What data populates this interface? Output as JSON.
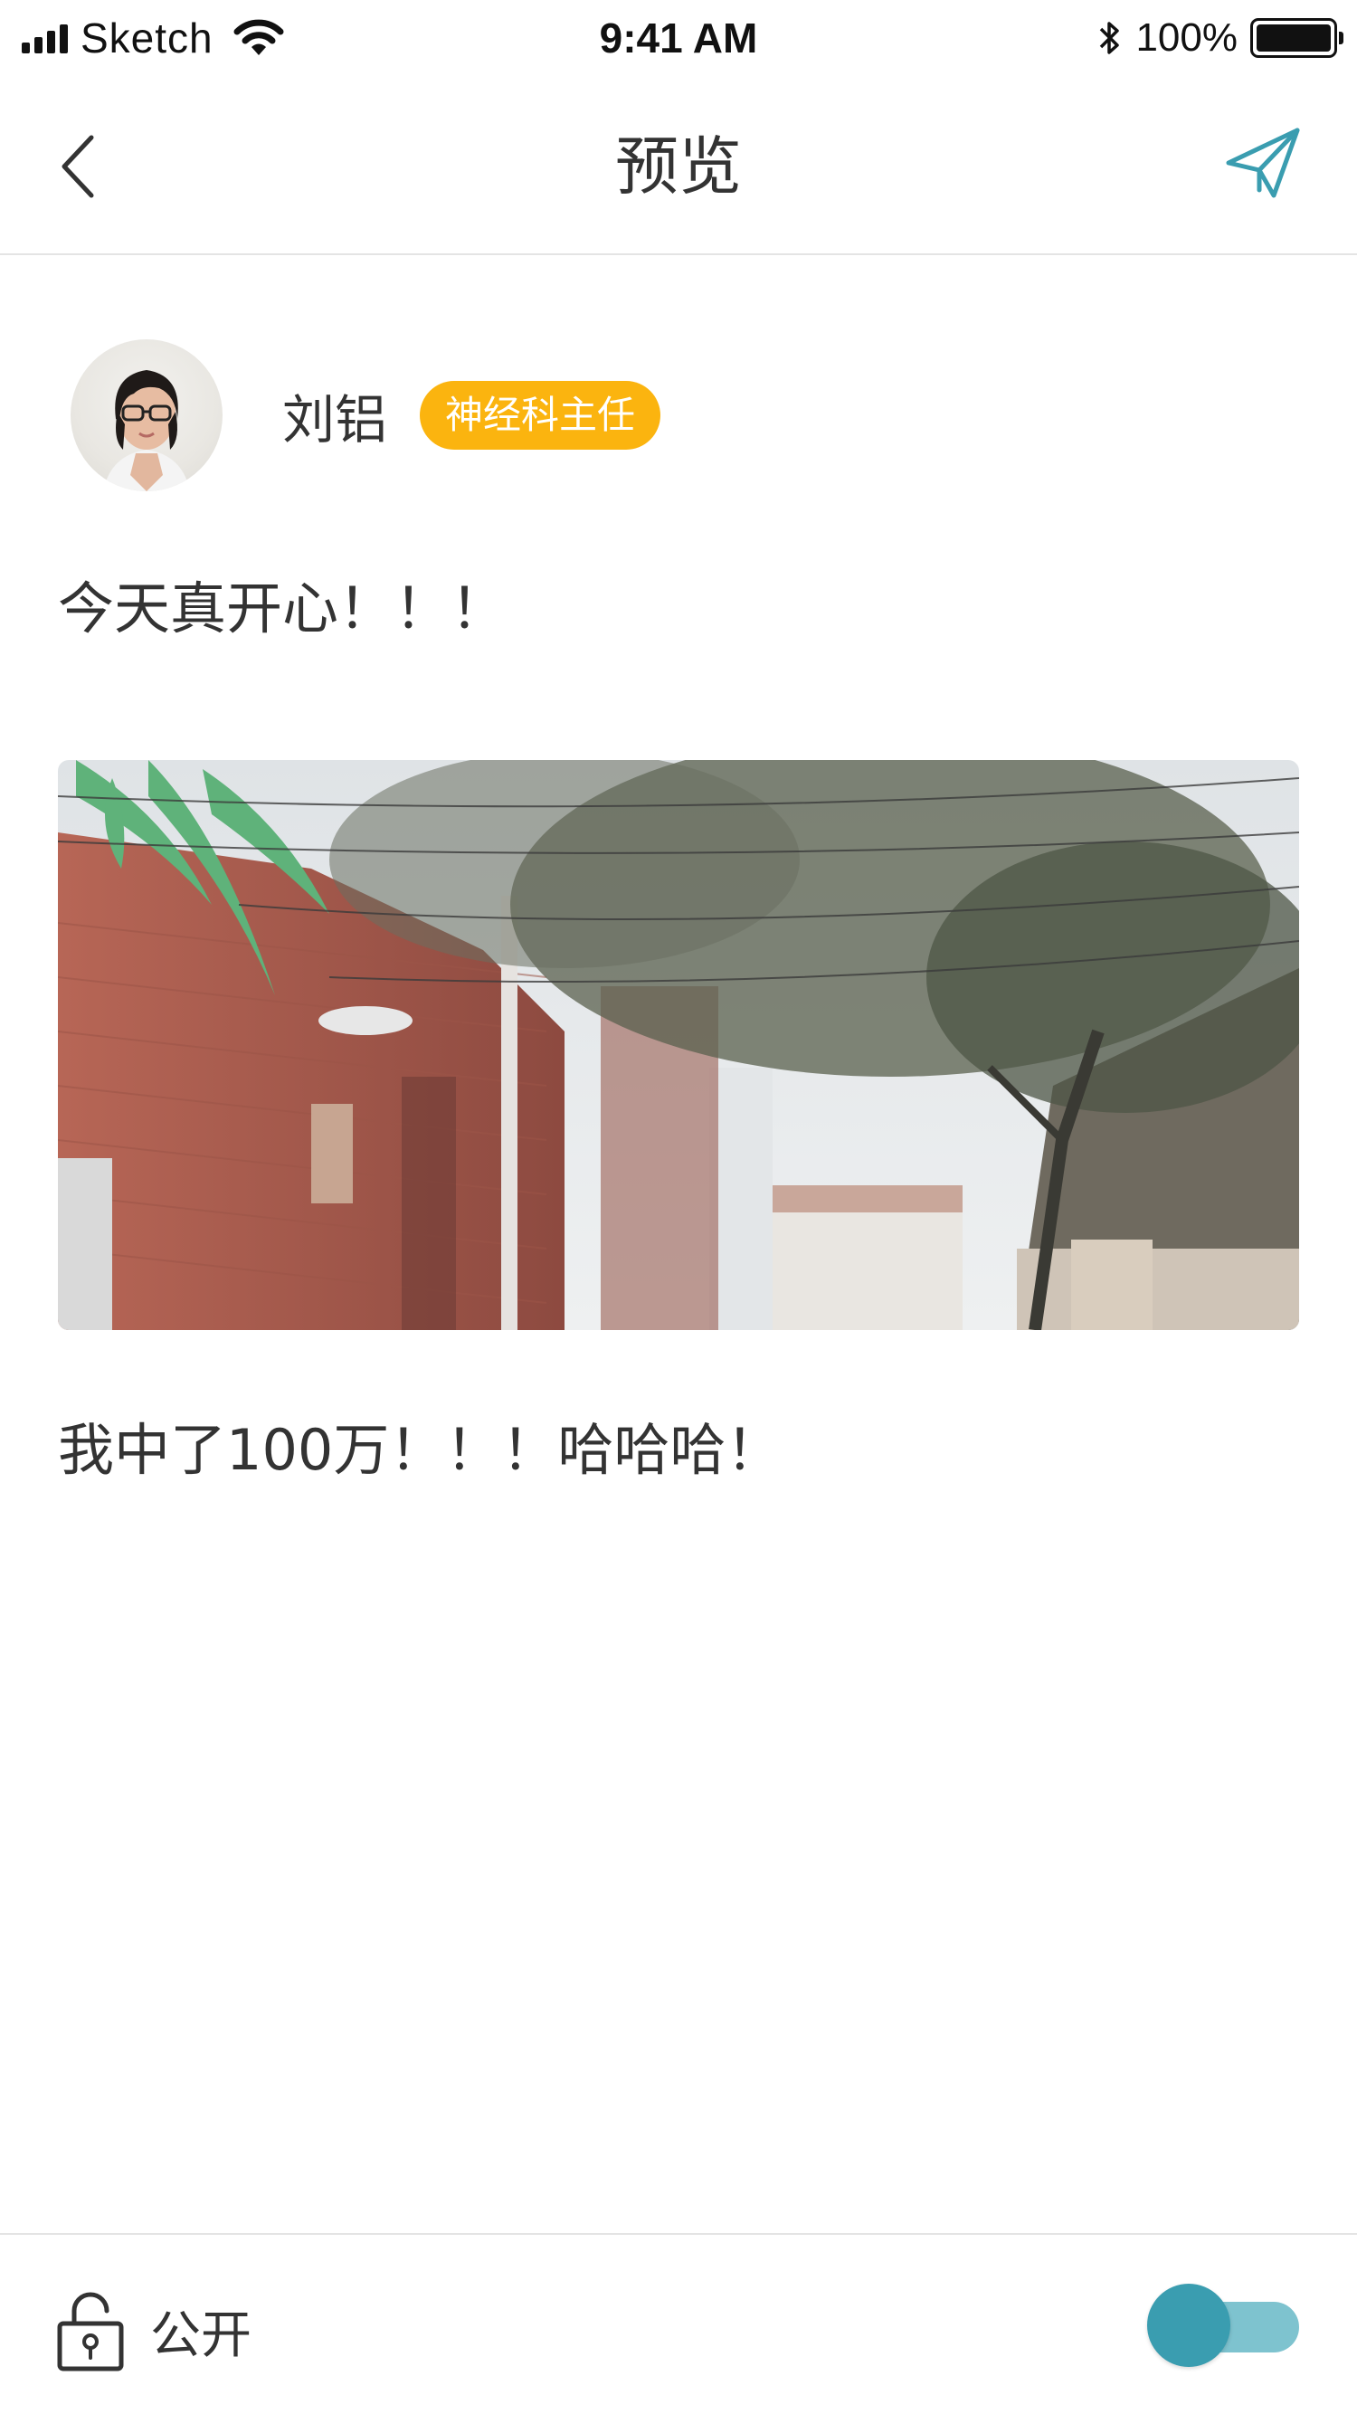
{
  "status_bar": {
    "carrier": "Sketch",
    "time": "9:41 AM",
    "bluetooth": "✱",
    "battery_percent": "100%"
  },
  "nav": {
    "title": "预览",
    "back_icon": "chevron-left-icon",
    "send_icon": "paper-plane-icon"
  },
  "author": {
    "name": "刘铝",
    "role": "神经科主任"
  },
  "post": {
    "text_1": "今天真开心！！！",
    "text_2": "我中了100万！！！哈哈哈！"
  },
  "bottom_bar": {
    "privacy_label": "公开",
    "privacy_icon": "unlocked-padlock-icon",
    "toggle_on": true
  },
  "colors": {
    "accent": "#3a9db0",
    "accent_light": "#7ec3cf",
    "badge": "#fbb40f",
    "text": "#333333",
    "divider": "#e4e4e4"
  }
}
